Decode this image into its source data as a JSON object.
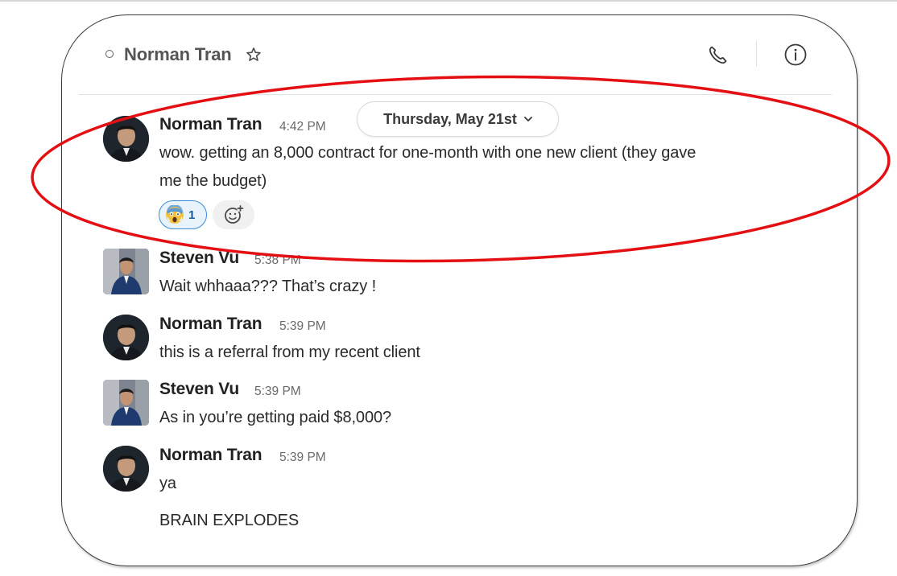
{
  "header": {
    "channel_name": "Norman Tran"
  },
  "date_divider": {
    "label": "Thursday, May 21st"
  },
  "messages": [
    {
      "author": "Norman Tran",
      "time": "4:42 PM",
      "lines": [
        "wow. getting an 8,000 contract for one-month with one new client (they gave",
        "me the budget)"
      ],
      "reaction": {
        "emoji": "scream-emoji",
        "count": "1"
      }
    },
    {
      "author": "Steven Vu",
      "time": "5:38 PM",
      "lines": [
        "Wait whhaaa??? That’s crazy !"
      ]
    },
    {
      "author": "Norman Tran",
      "time": "5:39 PM",
      "lines": [
        "this is a referral from my recent client"
      ]
    },
    {
      "author": "Steven Vu",
      "time": "5:39 PM",
      "lines": [
        "As in you’re getting paid $8,000?"
      ]
    },
    {
      "author": "Norman Tran",
      "time": "5:39 PM",
      "lines": [
        "ya"
      ],
      "followup": "BRAIN EXPLODES"
    }
  ],
  "annotation": {
    "ellipse_color": "#e30f13"
  }
}
